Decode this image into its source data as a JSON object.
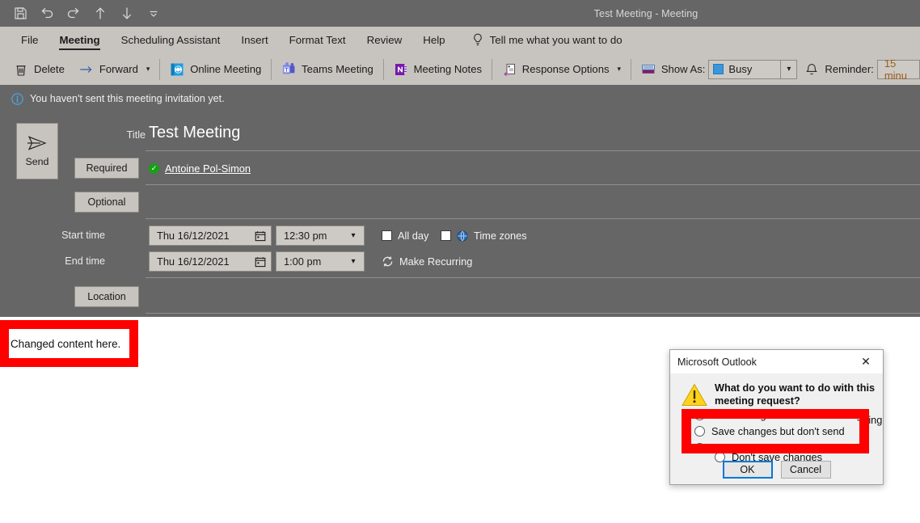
{
  "window": {
    "title": "Test Meeting  -  Meeting",
    "quick_access": [
      {
        "name": "save-icon",
        "label": "Save"
      },
      {
        "name": "undo-icon",
        "label": "Undo"
      },
      {
        "name": "redo-icon",
        "label": "Redo"
      },
      {
        "name": "previous-item-icon",
        "label": "Previous Item"
      },
      {
        "name": "next-item-icon",
        "label": "Next Item"
      },
      {
        "name": "customize-quick-access-toolbar-icon",
        "label": "Customize Quick Access Toolbar"
      }
    ]
  },
  "tabs": [
    {
      "label": "File",
      "active": false
    },
    {
      "label": "Meeting",
      "active": true
    },
    {
      "label": "Scheduling Assistant",
      "active": false
    },
    {
      "label": "Insert",
      "active": false
    },
    {
      "label": "Format Text",
      "active": false
    },
    {
      "label": "Review",
      "active": false
    },
    {
      "label": "Help",
      "active": false
    }
  ],
  "tell_me": {
    "placeholder": "Tell me what you want to do"
  },
  "ribbon": {
    "delete_label": "Delete",
    "forward_label": "Forward",
    "online_meeting_label": "Online Meeting",
    "teams_meeting_label": "Teams Meeting",
    "meeting_notes_label": "Meeting Notes",
    "response_options_label": "Response Options",
    "show_as_label": "Show As:",
    "show_as_value": "Busy",
    "show_as_color": "#3a96dd",
    "reminder_label": "Reminder:",
    "reminder_value": "15 minu"
  },
  "infobar": {
    "text": "You haven't sent this meeting invitation yet."
  },
  "form": {
    "send_label": "Send",
    "title_label": "Title",
    "title_value": "Test Meeting",
    "required_label": "Required",
    "required_value": "Antoine Pol-Simon",
    "optional_label": "Optional",
    "optional_value": "",
    "start_time_label": "Start time",
    "start_date_value": "Thu 16/12/2021",
    "start_time_value": "12:30 pm",
    "end_time_label": "End time",
    "end_date_value": "Thu 16/12/2021",
    "end_time_value": "1:00 pm",
    "all_day_label": "All day",
    "time_zones_label": "Time zones",
    "make_recurring_label": "Make Recurring",
    "location_label": "Location",
    "location_value": ""
  },
  "body": {
    "text": "Changed content here."
  },
  "annotations": {
    "body_highlight_text": "Changed content here.",
    "radio_highlight_top_text": "Save changes and send meeting",
    "radio_highlight_text": "Save changes but don't send",
    "radio_highlight_bottom_text": "Don't save changes",
    "color": "#fe0000"
  },
  "dialog": {
    "title": "Microsoft Outlook",
    "message": "What do you want to do with this meeting request?",
    "options": [
      {
        "label": "Save changes and send meeting",
        "selected": false
      },
      {
        "label": "Save changes but don't send",
        "selected": false
      },
      {
        "label": "Don't save changes",
        "selected": false
      }
    ],
    "ok_label": "OK",
    "cancel_label": "Cancel"
  }
}
